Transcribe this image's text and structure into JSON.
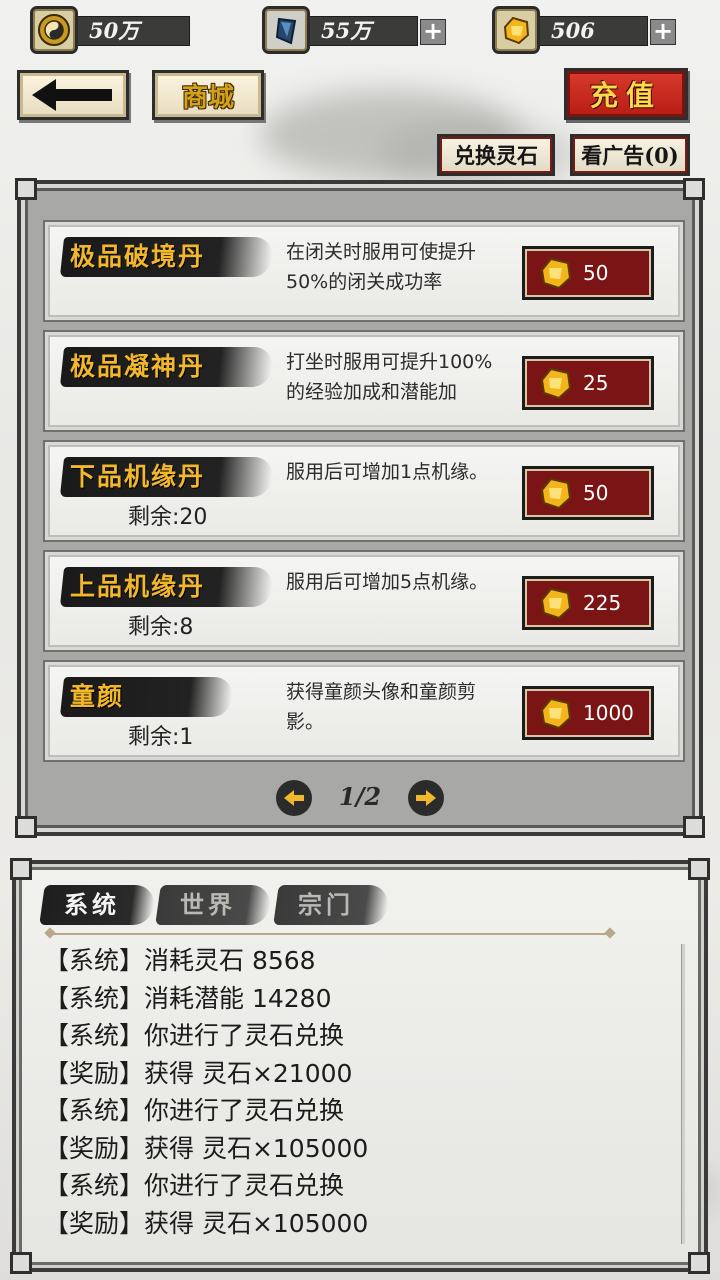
{
  "resources": [
    {
      "icon": "yin-yang-icon",
      "value": "50万",
      "has_plus": false
    },
    {
      "icon": "blue-crystal-icon",
      "value": "55万",
      "has_plus": true
    },
    {
      "icon": "gold-gem-icon",
      "value": "506",
      "has_plus": true
    }
  ],
  "nav": {
    "back_icon": "back-arrow-icon",
    "shop_label": "商城",
    "recharge_label": "充值",
    "exchange_label": "兑换灵石",
    "watch_ad_label": "看广告(0)"
  },
  "shop": {
    "items": [
      {
        "name": "极品破境丹",
        "stock": "",
        "desc": "在闭关时服用可使提升50%的闭关成功率",
        "price": "50"
      },
      {
        "name": "极品凝神丹",
        "stock": "",
        "desc": "打坐时服用可提升100%的经验加成和潜能加",
        "price": "25"
      },
      {
        "name": "下品机缘丹",
        "stock": "剩余:20",
        "desc": "服用后可增加1点机缘。",
        "price": "50"
      },
      {
        "name": "上品机缘丹",
        "stock": "剩余:8",
        "desc": "服用后可增加5点机缘。",
        "price": "225"
      },
      {
        "name": "童颜",
        "stock": "剩余:1",
        "desc": "获得童颜头像和童颜剪影。",
        "price": "1000"
      }
    ],
    "page": "1/2",
    "price_icon": "gold-gem-icon"
  },
  "chat": {
    "tabs": [
      {
        "label": "系统",
        "active": true
      },
      {
        "label": "世界",
        "active": false
      },
      {
        "label": "宗门",
        "active": false
      }
    ],
    "lines": [
      "【系统】消耗灵石 8568",
      "【系统】消耗潜能 14280",
      "【系统】你进行了灵石兑换",
      "【奖励】获得 灵石×21000",
      "【系统】你进行了灵石兑换",
      "【奖励】获得 灵石×105000",
      "【系统】你进行了灵石兑换",
      "【奖励】获得 灵石×105000"
    ]
  }
}
